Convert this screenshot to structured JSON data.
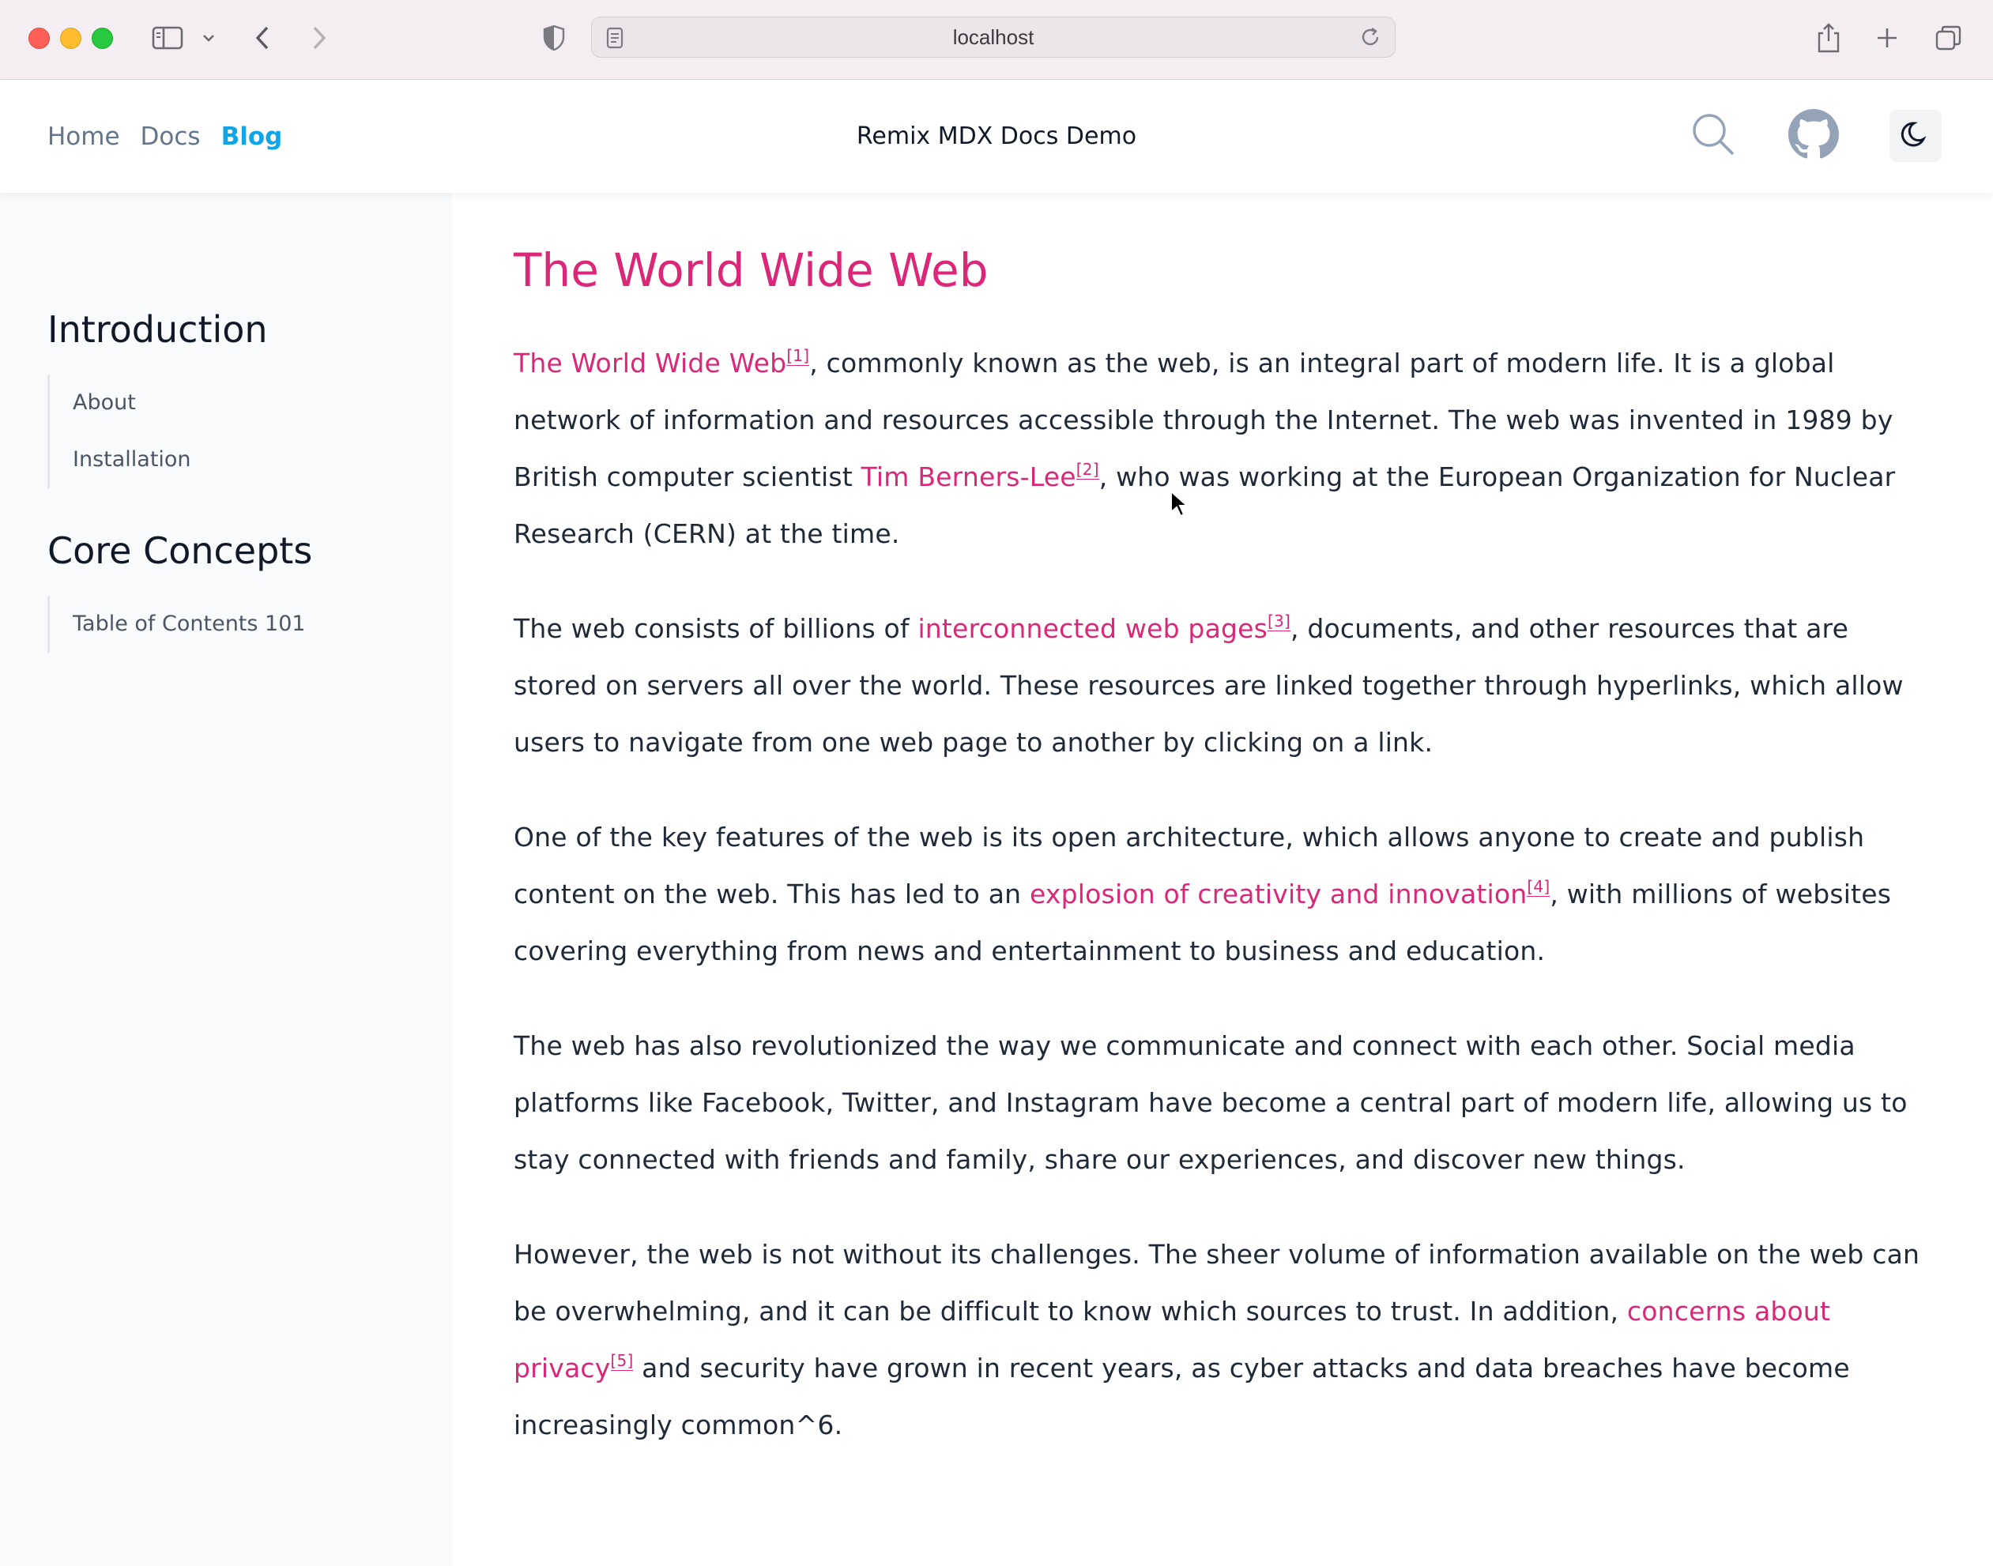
{
  "browser": {
    "url": "localhost"
  },
  "header": {
    "nav": [
      "Home",
      "Docs",
      "Blog"
    ],
    "active_nav": "Blog",
    "site_title": "Remix MDX Docs Demo"
  },
  "sidebar": {
    "sections": [
      {
        "heading": "Introduction",
        "items": [
          "About",
          "Installation"
        ]
      },
      {
        "heading": "Core Concepts",
        "items": [
          "Table of Contents 101"
        ]
      }
    ]
  },
  "article": {
    "title": "The World Wide Web",
    "p1": {
      "link1": "The World Wide Web",
      "ref1": "[1]",
      "text1": ", commonly known as the web, is an integral part of modern life. It is a global network of information and resources accessible through the Internet. The web was invented in 1989 by British computer scientist ",
      "link2": "Tim Berners-Lee",
      "ref2": "[2]",
      "text2": ", who was working at the European Organization for Nuclear Research (CERN) at the time."
    },
    "p2": {
      "text1": "The web consists of billions of ",
      "link1": "interconnected web pages",
      "ref1": "[3]",
      "text2": ", documents, and other resources that are stored on servers all over the world. These resources are linked together through hyperlinks, which allow users to navigate from one web page to another by clicking on a link."
    },
    "p3": {
      "text1": "One of the key features of the web is its open architecture, which allows anyone to create and publish content on the web. This has led to an ",
      "link1": "explosion of creativity and innovation",
      "ref1": "[4]",
      "text2": ", with millions of websites covering everything from news and entertainment to business and education."
    },
    "p4": {
      "text1": "The web has also revolutionized the way we communicate and connect with each other. Social media platforms like Facebook, Twitter, and Instagram have become a central part of modern life, allowing us to stay connected with friends and family, share our experiences, and discover new things."
    },
    "p5": {
      "text1": "However, the web is not without its challenges. The sheer volume of information available on the web can be overwhelming, and it can be difficult to know which sources to trust. In addition, ",
      "link1": "concerns about privacy",
      "ref1": "[5]",
      "text2": " and security have grown in recent years, as cyber attacks and data breaches have become increasingly common^6."
    }
  }
}
